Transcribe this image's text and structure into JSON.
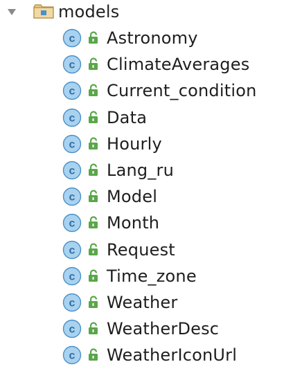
{
  "tree": {
    "package": {
      "label": "models",
      "expanded": true,
      "icon": "package-folder-icon"
    },
    "classes": [
      {
        "label": "Astronomy",
        "icon": "class-icon",
        "access": "public-lock-icon"
      },
      {
        "label": "ClimateAverages",
        "icon": "class-icon",
        "access": "public-lock-icon"
      },
      {
        "label": "Current_condition",
        "icon": "class-icon",
        "access": "public-lock-icon"
      },
      {
        "label": "Data",
        "icon": "class-icon",
        "access": "public-lock-icon"
      },
      {
        "label": "Hourly",
        "icon": "class-icon",
        "access": "public-lock-icon"
      },
      {
        "label": "Lang_ru",
        "icon": "class-icon",
        "access": "public-lock-icon"
      },
      {
        "label": "Model",
        "icon": "class-icon",
        "access": "public-lock-icon"
      },
      {
        "label": "Month",
        "icon": "class-icon",
        "access": "public-lock-icon"
      },
      {
        "label": "Request",
        "icon": "class-icon",
        "access": "public-lock-icon"
      },
      {
        "label": "Time_zone",
        "icon": "class-icon",
        "access": "public-lock-icon"
      },
      {
        "label": "Weather",
        "icon": "class-icon",
        "access": "public-lock-icon"
      },
      {
        "label": "WeatherDesc",
        "icon": "class-icon",
        "access": "public-lock-icon"
      },
      {
        "label": "WeatherIconUrl",
        "icon": "class-icon",
        "access": "public-lock-icon"
      }
    ]
  },
  "colors": {
    "class_icon_fill": "#a9d2ef",
    "class_icon_stroke": "#4a90c8",
    "class_icon_letter": "#2f6ea8",
    "lock_fill": "#5aa64a",
    "folder_fill": "#e7c98a",
    "folder_stroke": "#b08a3e",
    "disclosure": "#8a8a8a"
  }
}
